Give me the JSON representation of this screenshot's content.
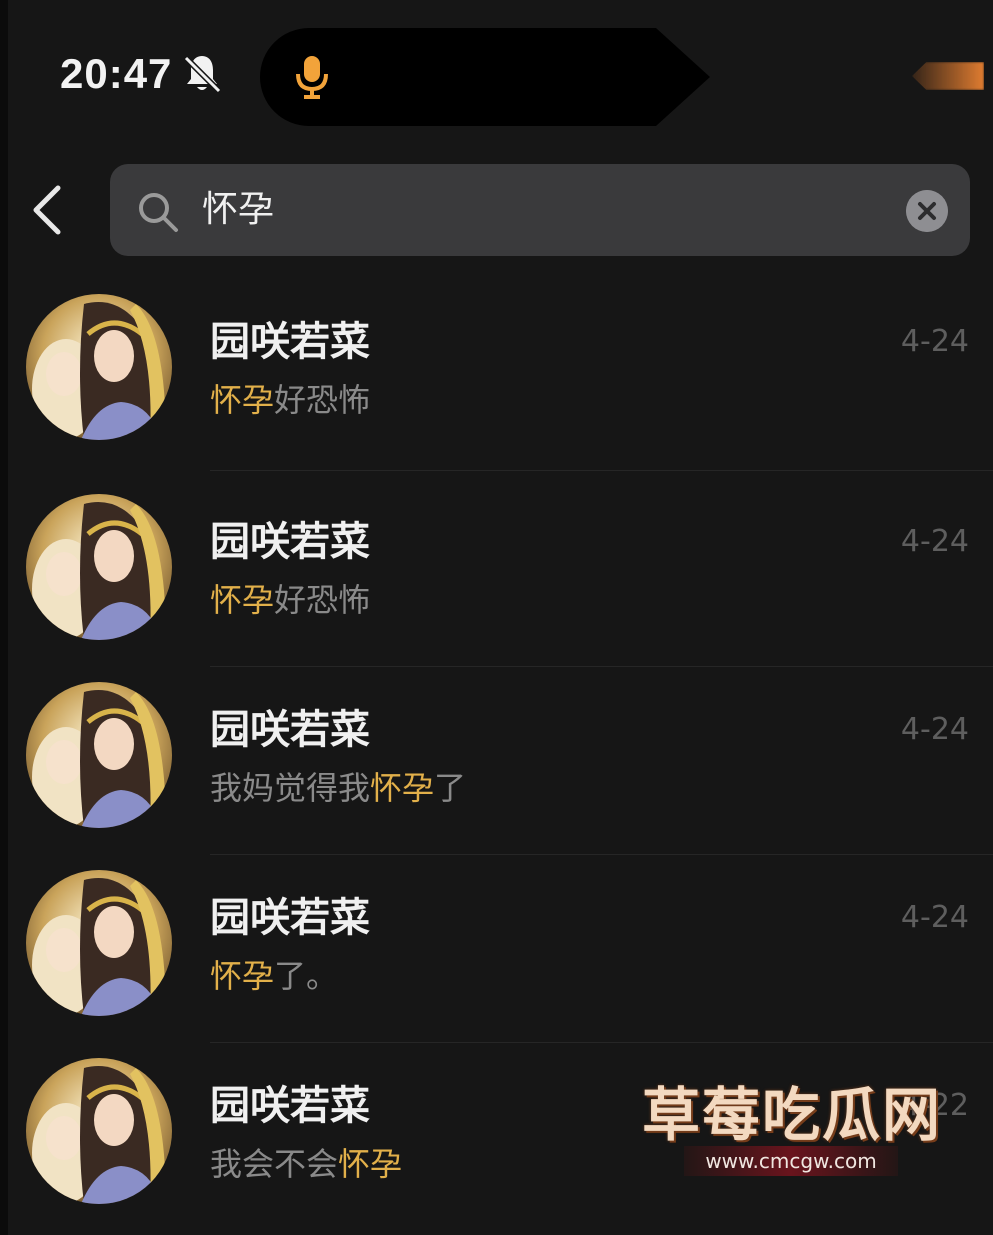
{
  "status_bar": {
    "time": "20:47",
    "silent_icon": "bell-slash-icon",
    "mic_icon": "microphone-icon"
  },
  "header": {
    "back_icon": "chevron-left-icon",
    "search": {
      "icon": "search-icon",
      "value": "怀孕",
      "clear_icon": "clear-icon"
    }
  },
  "results": [
    {
      "name": "园咲若菜",
      "preview_parts": [
        {
          "text": "怀孕",
          "highlight": true
        },
        {
          "text": "好恐怖",
          "highlight": false
        }
      ],
      "date": "4-24"
    },
    {
      "name": "园咲若菜",
      "preview_parts": [
        {
          "text": "怀孕",
          "highlight": true
        },
        {
          "text": "好恐怖",
          "highlight": false
        }
      ],
      "date": "4-24"
    },
    {
      "name": "园咲若菜",
      "preview_parts": [
        {
          "text": "我妈觉得我",
          "highlight": false
        },
        {
          "text": "怀孕",
          "highlight": true
        },
        {
          "text": "了",
          "highlight": false
        }
      ],
      "date": "4-24"
    },
    {
      "name": "园咲若菜",
      "preview_parts": [
        {
          "text": "怀孕",
          "highlight": true
        },
        {
          "text": "了。",
          "highlight": false
        }
      ],
      "date": "4-24"
    },
    {
      "name": "园咲若菜",
      "preview_parts": [
        {
          "text": "我会不会",
          "highlight": false
        },
        {
          "text": "怀孕",
          "highlight": true
        }
      ],
      "date": "4-22"
    }
  ],
  "watermark": {
    "title": "草莓吃瓜网",
    "url": "www.cmcgw.com"
  },
  "colors": {
    "background": "#161616",
    "highlight": "#e2b04a",
    "preview_text": "#8a8a8a",
    "date_text": "#5e5e5e",
    "mic": "#f2a33a"
  }
}
